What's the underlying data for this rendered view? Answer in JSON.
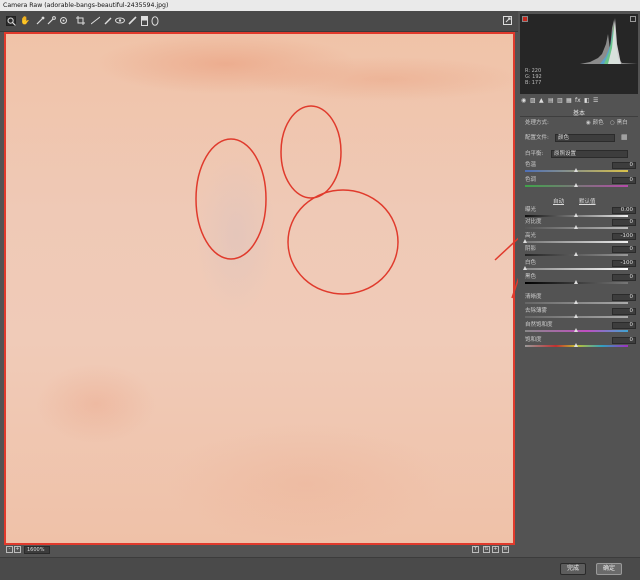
{
  "window": {
    "title": "Camera Raw (adorable-bangs-beautiful-2435594.jpg)"
  },
  "toolbar": {
    "tools": [
      "zoom-icon",
      "hand-icon",
      "white-balance-icon",
      "color-sampler-icon",
      "targeted-adjust-icon",
      "crop-icon",
      "straighten-icon",
      "spot-removal-icon",
      "redeye-icon",
      "brush-icon",
      "graduated-filter-icon",
      "radial-filter-icon"
    ]
  },
  "histogram": {
    "r_label": "R:",
    "r_value": "220",
    "g_label": "G:",
    "g_value": "192",
    "b_label": "B:",
    "b_value": "177"
  },
  "panel": {
    "section_title": "基本",
    "treatment_label": "处理方式:",
    "treatment_color": "颜色",
    "treatment_bw": "黑白",
    "profile_label": "配置文件:",
    "profile_value": "颜色",
    "wb_label": "白平衡:",
    "wb_value": "原照设置",
    "auto_label": "自动",
    "default_label": "默认值",
    "sliders": {
      "temp": {
        "label": "色温",
        "value": "0",
        "pos": 0.5
      },
      "tint": {
        "label": "色调",
        "value": "0",
        "pos": 0.5
      },
      "exposure": {
        "label": "曝光",
        "value": "0.00",
        "pos": 0.5
      },
      "contrast": {
        "label": "对比度",
        "value": "0",
        "pos": 0.5
      },
      "highlights": {
        "label": "高光",
        "value": "-100",
        "pos": 0.0
      },
      "shadows": {
        "label": "阴影",
        "value": "0",
        "pos": 0.5
      },
      "whites": {
        "label": "白色",
        "value": "-100",
        "pos": 0.0
      },
      "blacks": {
        "label": "黑色",
        "value": "0",
        "pos": 0.5
      },
      "clarity": {
        "label": "清晰度",
        "value": "0",
        "pos": 0.5
      },
      "dehaze": {
        "label": "去除薄雾",
        "value": "0",
        "pos": 0.5
      },
      "vibrance": {
        "label": "自然饱和度",
        "value": "0",
        "pos": 0.5
      },
      "saturation": {
        "label": "饱和度",
        "value": "0",
        "pos": 0.5
      }
    }
  },
  "status": {
    "zoom": "1600%"
  },
  "footer": {
    "done_label": "完成",
    "ok_label": "确定"
  },
  "colors": {
    "annotation": "#e03a2c",
    "background": "#535353"
  }
}
